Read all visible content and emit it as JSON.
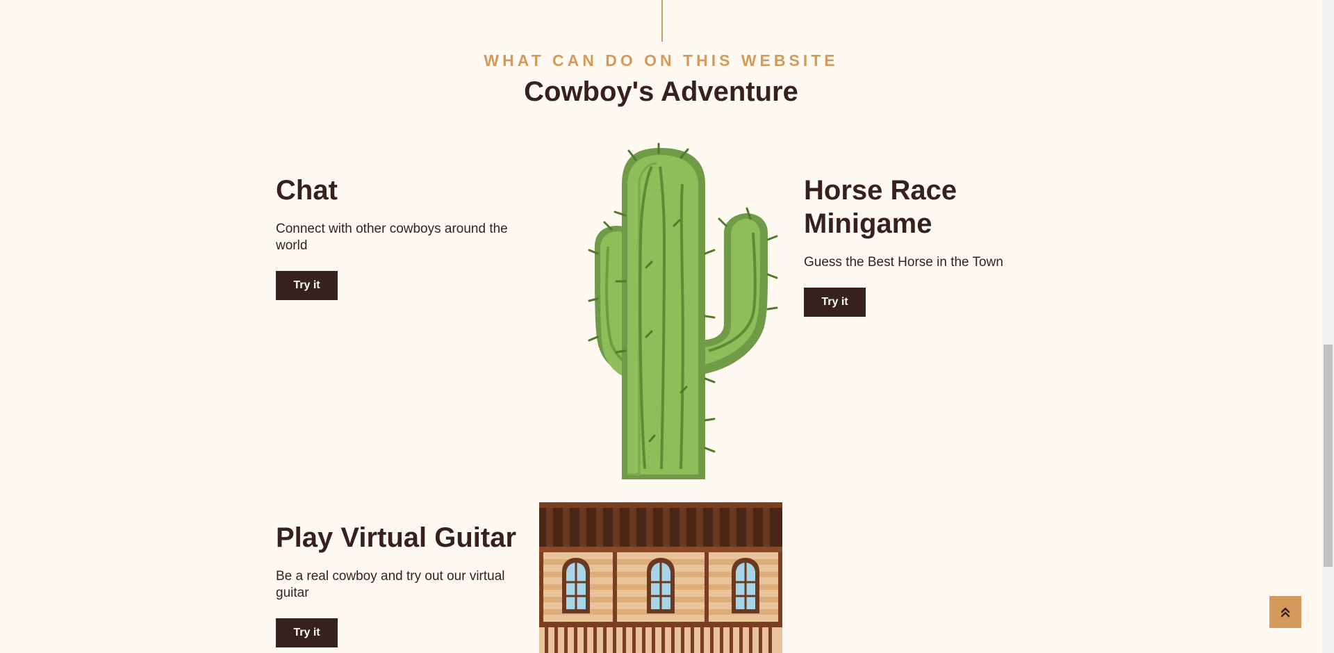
{
  "section": {
    "eyebrow": "WHAT CAN DO ON THIS WEBSITE",
    "title": "Cowboy's Adventure"
  },
  "features": [
    {
      "title": "Chat",
      "description": "Connect with other cowboys around the world",
      "button_label": "Try it"
    },
    {
      "title": "Horse Race Minigame",
      "description": "Guess the Best Horse in the Town",
      "button_label": "Try it"
    },
    {
      "title": "Play Virtual Guitar",
      "description": "Be a real cowboy and try out our virtual guitar",
      "button_label": "Try it"
    }
  ],
  "images": {
    "cactus": "cactus-illustration",
    "saloon": "saloon-building-illustration"
  },
  "back_to_top_icon": "double-chevron-up-icon",
  "colors": {
    "background": "#fffaf1",
    "accent": "#d49a5c",
    "text": "#36211d",
    "button_bg": "#36211d",
    "button_text": "#ffffff"
  }
}
